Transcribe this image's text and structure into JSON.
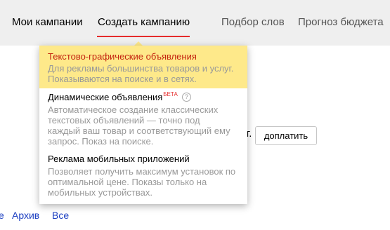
{
  "tabs": {
    "my_campaigns": "Мои кампании",
    "create_campaign": "Создать кампанию",
    "word_selection": "Подбор слов",
    "budget_forecast": "Прогноз бюджета"
  },
  "colors": {
    "accent_red": "#e52b2b",
    "highlight_yellow": "#fee98a",
    "link_blue": "#1a3dc1"
  },
  "page": {
    "partial_text": "т.",
    "pay_button": "доплатить",
    "bottom_links": [
      "е",
      "Архив",
      "Все"
    ]
  },
  "dropdown": {
    "items": [
      {
        "title": "Текстово-графические объявления",
        "description": [
          "Для рекламы большинства товаров и услуг.",
          "Показываются на поиске и в сетях."
        ]
      },
      {
        "title": "Динамические объявления",
        "badge": "БЕТА",
        "help_icon": "question-circle-icon",
        "description": [
          "Автоматическое создание классических",
          "текстовых объявлений — точно под",
          "каждый ваш товар и соответствующий ему",
          "запрос. Показ на поиске."
        ]
      },
      {
        "title": "Реклама мобильных приложений",
        "description": [
          "Позволяет получить максимум установок по",
          "оптимальной цене. Показы только на",
          "мобильных устройствах."
        ]
      }
    ]
  }
}
